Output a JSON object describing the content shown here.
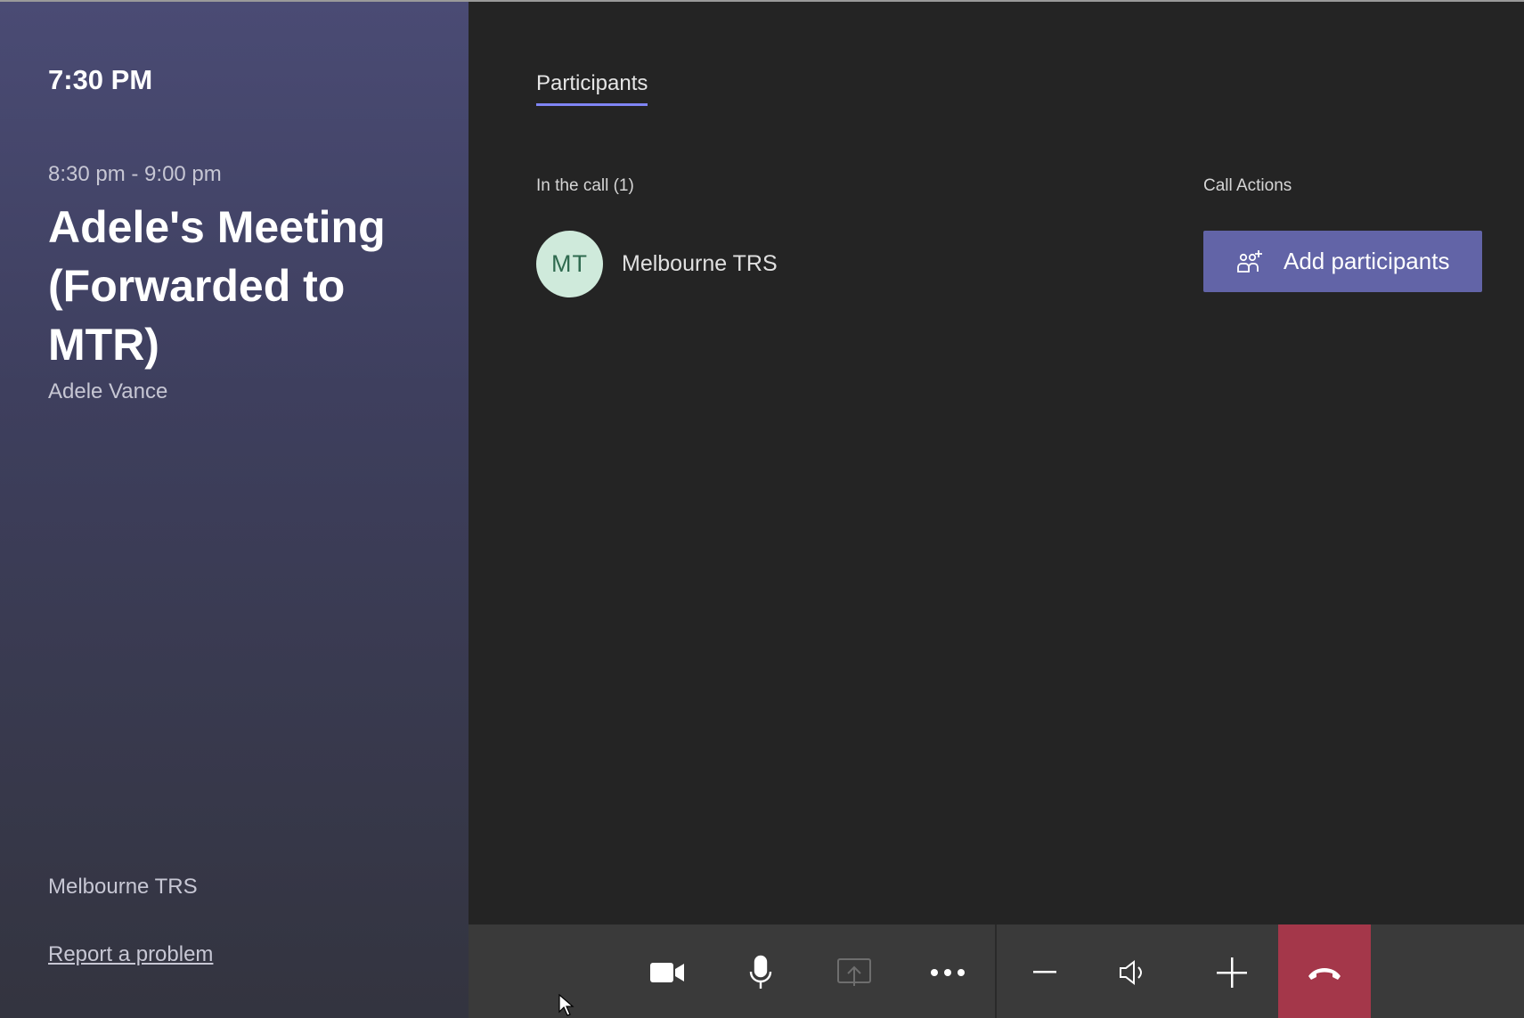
{
  "sidebar": {
    "clock": "7:30 PM",
    "time_range": "8:30 pm - 9:00 pm",
    "meeting_title": "Adele's Meeting (Forwarded to MTR)",
    "organizer": "Adele Vance",
    "room_name": "Melbourne TRS",
    "report_link": "Report a problem"
  },
  "main": {
    "tab_label": "Participants",
    "in_call_heading": "In the call (1)",
    "participants": [
      {
        "initials": "MT",
        "name": "Melbourne TRS"
      }
    ],
    "call_actions_heading": "Call Actions",
    "add_participants_label": "Add participants"
  },
  "controls": [
    {
      "name": "camera",
      "icon": "video-camera-icon"
    },
    {
      "name": "microphone",
      "icon": "microphone-icon"
    },
    {
      "name": "share",
      "icon": "share-screen-icon",
      "disabled": true
    },
    {
      "name": "more",
      "icon": "more-options-icon"
    },
    {
      "name": "volume-down",
      "icon": "minus-icon"
    },
    {
      "name": "speaker",
      "icon": "speaker-icon"
    },
    {
      "name": "volume-up",
      "icon": "plus-icon"
    },
    {
      "name": "hang-up",
      "icon": "hang-up-icon"
    }
  ],
  "colors": {
    "accent": "#6264a7",
    "tab_underline": "#7f85f5",
    "hangup": "#a4374a",
    "avatar_bg": "#cfeadb",
    "avatar_text": "#2f6a4f"
  }
}
